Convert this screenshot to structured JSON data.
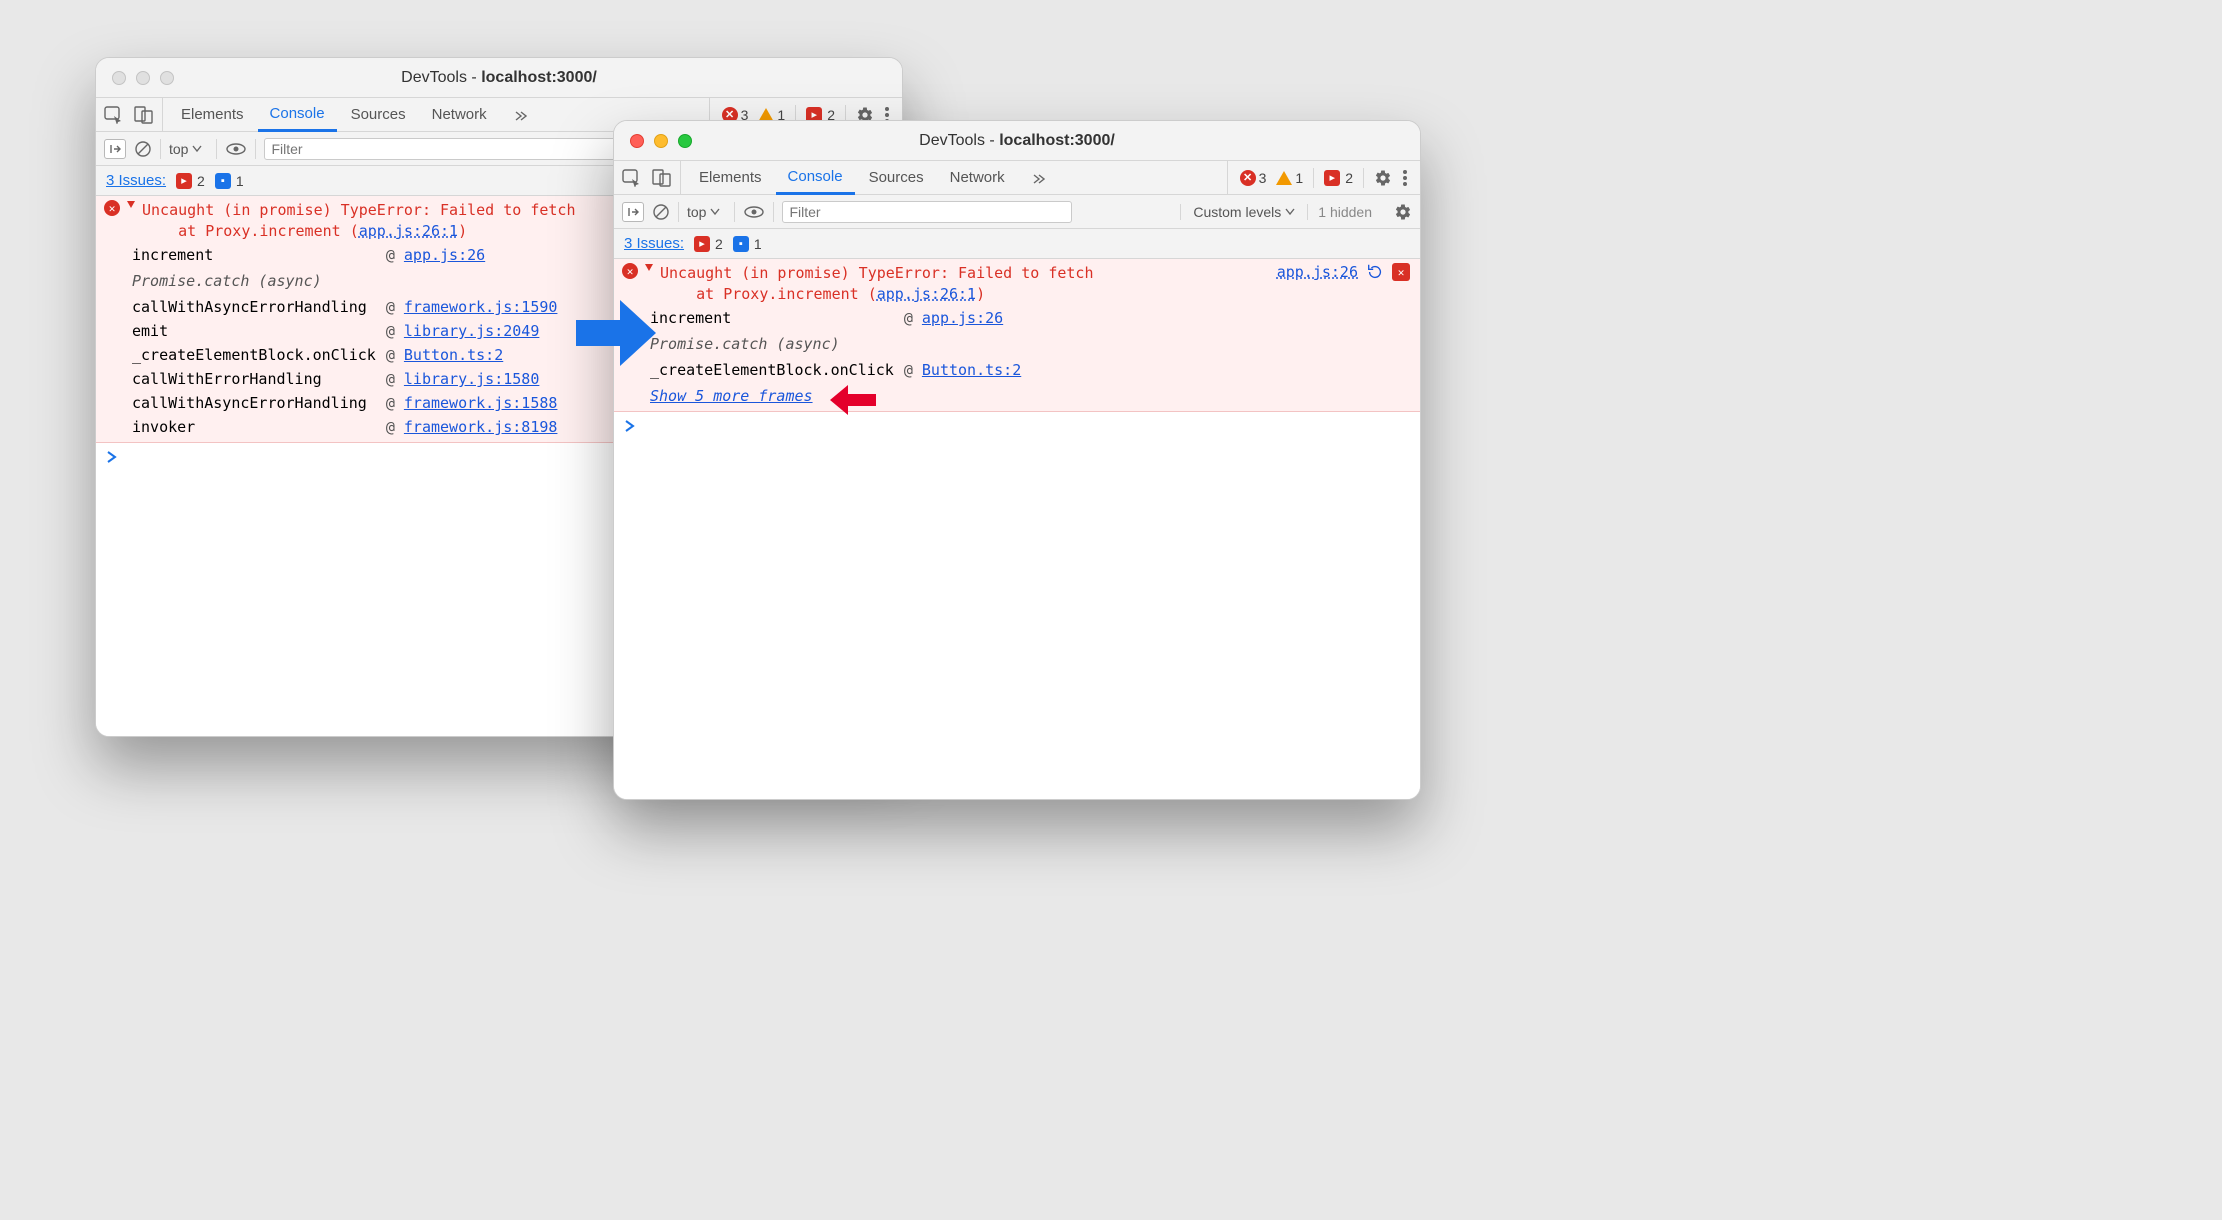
{
  "window_a": {
    "title_prefix": "DevTools - ",
    "title_url": "localhost:3000/",
    "tabs": [
      "Elements",
      "Console",
      "Sources",
      "Network"
    ],
    "active_tab": "Console",
    "counters": {
      "errors": "3",
      "warnings": "1",
      "flags": "2"
    },
    "toolbar": {
      "context": "top",
      "filter_placeholder": "Filter"
    },
    "issues": {
      "label": "3 Issues:",
      "red": "2",
      "blue": "1"
    },
    "error": {
      "headline": "Uncaught (in promise) TypeError: Failed to fetch",
      "at_line": "at Proxy.increment (",
      "at_link": "app.js:26:1",
      "at_close": ")",
      "async_label": "Promise.catch (async)",
      "frames": [
        {
          "fn": "increment",
          "loc": "app.js:26"
        },
        {
          "fn": "callWithAsyncErrorHandling",
          "loc": "framework.js:1590"
        },
        {
          "fn": "emit",
          "loc": "library.js:2049"
        },
        {
          "fn": "_createElementBlock.onClick",
          "loc": "Button.ts:2"
        },
        {
          "fn": "callWithErrorHandling",
          "loc": "library.js:1580"
        },
        {
          "fn": "callWithAsyncErrorHandling",
          "loc": "framework.js:1588"
        },
        {
          "fn": "invoker",
          "loc": "framework.js:8198"
        }
      ]
    }
  },
  "window_b": {
    "title_prefix": "DevTools - ",
    "title_url": "localhost:3000/",
    "tabs": [
      "Elements",
      "Console",
      "Sources",
      "Network"
    ],
    "active_tab": "Console",
    "counters": {
      "errors": "3",
      "warnings": "1",
      "flags": "2"
    },
    "toolbar": {
      "context": "top",
      "filter_placeholder": "Filter",
      "levels": "Custom levels",
      "hidden": "1 hidden"
    },
    "issues": {
      "label": "3 Issues:",
      "red": "2",
      "blue": "1"
    },
    "error": {
      "headline": "Uncaught (in promise) TypeError: Failed to fetch",
      "at_line": "at Proxy.increment (",
      "at_link": "app.js:26:1",
      "at_close": ")",
      "side_link": "app.js:26",
      "async_label": "Promise.catch (async)",
      "frames": [
        {
          "fn": "increment",
          "loc": "app.js:26"
        },
        {
          "fn": "_createElementBlock.onClick",
          "loc": "Button.ts:2"
        }
      ],
      "show_more": "Show 5 more frames"
    }
  }
}
